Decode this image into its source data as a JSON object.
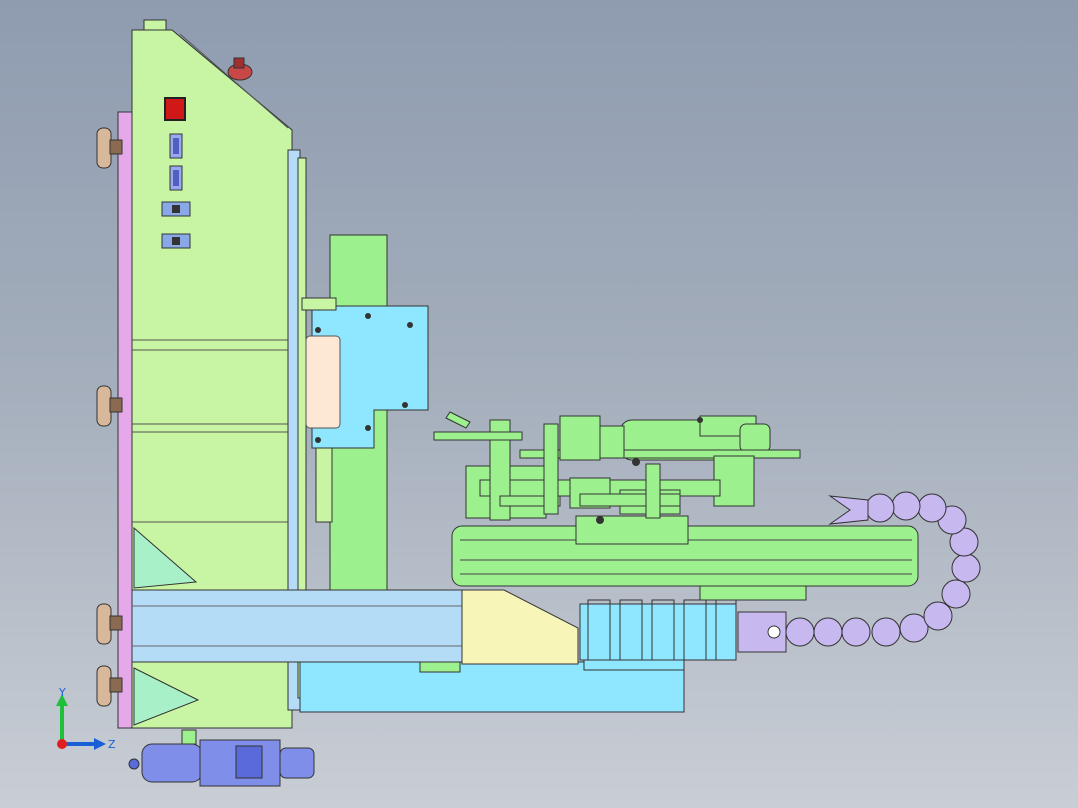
{
  "window": {
    "title": ""
  },
  "triad": {
    "y_label": "Y",
    "z_label": "Z",
    "colors": {
      "y": "#1fbf3a",
      "z": "#1a5fd6",
      "origin": "#e02020"
    }
  },
  "colors": {
    "background_top": "#8f9cb0",
    "background_bottom": "#c9ced5",
    "cabinet": "#c8f5a4",
    "green_part": "#9cf08e",
    "cyan_part": "#8fe6ff",
    "light_blue_part": "#b4dcf6",
    "purple_part": "#c8b8f0",
    "pink_panel": "#e5a8e8",
    "yellow_part": "#f8f5b8",
    "red_button": "#d01818",
    "motor_blue": "#7f8ee8"
  },
  "icons": [
    "cabinet-vent-icon",
    "emergency-stop-icon",
    "leveling-foot-icon",
    "connector-icon"
  ]
}
